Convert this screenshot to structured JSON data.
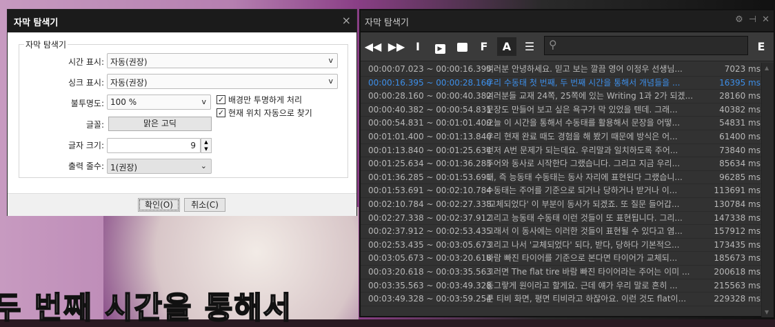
{
  "video": {
    "subtitle": "두 번째 시간을 통해서"
  },
  "dialog": {
    "title": "자막 탐색기",
    "close": "×",
    "group": "자막 탐색기",
    "time_label": "시간 표시:",
    "time_value": "자동(권장)",
    "sync_label": "싱크 표시:",
    "sync_value": "자동(권장)",
    "opacity_label": "불투명도:",
    "opacity_value": "100 %",
    "font_label": "글꼴:",
    "font_value": "맑은 고딕",
    "size_label": "글자 크기:",
    "size_value": "9",
    "lines_label": "출력 줄수:",
    "lines_value": "1(권장)",
    "chk_bg": "배경만 투명하게 처리",
    "chk_auto": "현재 위치 자동으로 찾기",
    "ok": "확인(O)",
    "cancel": "취소(C)"
  },
  "panel": {
    "title": "자막 탐색기",
    "tools": {
      "f": "F",
      "a": "A",
      "e": "E"
    },
    "items": [
      {
        "time": "00:00:07.023 ~ 00:00:16.395",
        "text": "여러분 안녕하세요. 믿고 보는 깔끔 영어 이정우 선생님...",
        "ms": "7023 ms"
      },
      {
        "time": "00:00:16.395 ~ 00:00:28.160",
        "text": "우리 수동태 첫 번째, 두 번째 시간을 통해서 개념들을 ...",
        "ms": "16395 ms"
      },
      {
        "time": "00:00:28.160 ~ 00:00:40.382",
        "text": "여러분들 교재 24쪽, 25쪽에 있는 Writing 1과 2가 되겠...",
        "ms": "28160 ms"
      },
      {
        "time": "00:00:40.382 ~ 00:00:54.831",
        "text": "문장도 만들어 보고 싶은 욕구가 막 있었을 텐데. 그래...",
        "ms": "40382 ms"
      },
      {
        "time": "00:00:54.831 ~ 00:01:01.400",
        "text": "오늘 이 시간을 통해서 수동태를 활용해서 문장을 어떻...",
        "ms": "54831 ms"
      },
      {
        "time": "00:01:01.400 ~ 00:01:13.840",
        "text": "우리 현재 완료 때도 경험을 해 봤기 때문에 방식은 어...",
        "ms": "61400 ms"
      },
      {
        "time": "00:01:13.840 ~ 00:01:25.634",
        "text": "먼저 A번 문제가 되는데요. 우리말과 일치하도록 주어...",
        "ms": "73840 ms"
      },
      {
        "time": "00:01:25.634 ~ 00:01:36.285",
        "text": "주어와 동사로 시작한다 그랬습니다. 그리고 지금 우리...",
        "ms": "85634 ms"
      },
      {
        "time": "00:01:36.285 ~ 00:01:53.691",
        "text": "태, 즉 능동태 수동태는 동사 자리에 표현된다 그랬습니...",
        "ms": "96285 ms"
      },
      {
        "time": "00:01:53.691 ~ 00:02:10.784",
        "text": "수동태는 주어를 기준으로 되거나 당하거나 받거나 이...",
        "ms": "113691 ms"
      },
      {
        "time": "00:02:10.784 ~ 00:02:27.338",
        "text": "'교체되었다' 이 부분이 동사가 되겠죠. 또 질문 들어갑...",
        "ms": "130784 ms"
      },
      {
        "time": "00:02:27.338 ~ 00:02:37.912",
        "text": "그리고 능동태 수동태 이런 것들이 또 표현됩니다. 그리...",
        "ms": "147338 ms"
      },
      {
        "time": "00:02:37.912 ~ 00:02:53.435",
        "text": "그래서 이 동사에는 이러한 것들이 표현될 수 있다고 염...",
        "ms": "157912 ms"
      },
      {
        "time": "00:02:53.435 ~ 00:03:05.673",
        "text": "그리고 나서 '교체되었다' 되다, 받다, 당하다 기본적으...",
        "ms": "173435 ms"
      },
      {
        "time": "00:03:05.673 ~ 00:03:20.618",
        "text": "바람 빠진 타이어를 기준으로 본다면 타이어가 교체되...",
        "ms": "185673 ms"
      },
      {
        "time": "00:03:20.618 ~ 00:03:35.563",
        "text": "그러면 The flat tire 바람 빠진 타이어라는 주어는 이미 ...",
        "ms": "200618 ms"
      },
      {
        "time": "00:03:35.563 ~ 00:03:49.328",
        "text": "동그랗게 원이라고 할게요. 근데 얘가 우리 말로 흔히 ...",
        "ms": "215563 ms"
      },
      {
        "time": "00:03:49.328 ~ 00:03:59.254",
        "text": "큰 티비 화면, 평면 티비라고 하잖아요. 이런 것도 flat이...",
        "ms": "229328 ms"
      }
    ]
  }
}
